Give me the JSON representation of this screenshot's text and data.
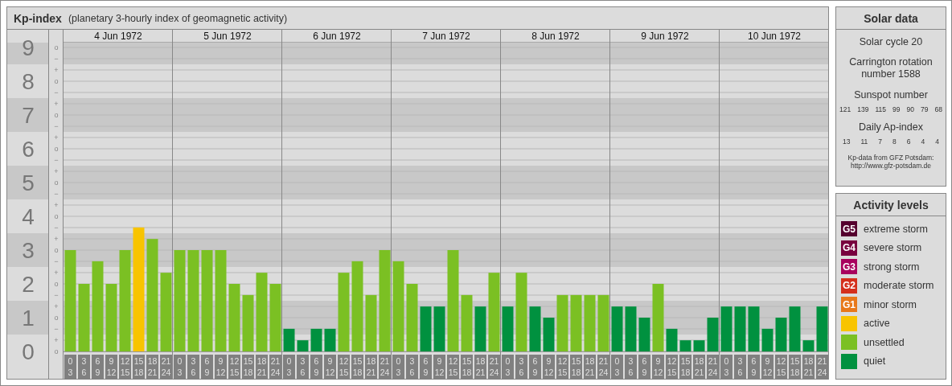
{
  "chart_panel": {
    "subtitle": "(planetary 3-hourly index of geomagnetic activity)",
    "chart_data": {
      "type": "bar",
      "title": "Kp-index",
      "grid": true,
      "ylim": [
        0,
        9
      ],
      "bands": [
        {
          "axis": "y",
          "from": 0.5,
          "to": 1.5
        },
        {
          "axis": "y",
          "from": 2.5,
          "to": 3.5
        },
        {
          "axis": "y",
          "from": 4.5,
          "to": 5.5
        },
        {
          "axis": "y",
          "from": 6.5,
          "to": 7.5
        },
        {
          "axis": "y",
          "from": 8.5,
          "to": 9.5
        }
      ],
      "yticks": [
        0,
        1,
        2,
        3,
        4,
        5,
        6,
        7,
        8,
        9
      ],
      "values": [
        3,
        2,
        2.67,
        2,
        3,
        3.67,
        3.33,
        2.33,
        3,
        3,
        3,
        3,
        2,
        1.67,
        2.33,
        2,
        0.67,
        0.33,
        0.67,
        0.67,
        2.33,
        2.67,
        1.67,
        3,
        2.67,
        2,
        1.33,
        1.33,
        3,
        1.67,
        1.33,
        2.33,
        1.33,
        2.33,
        1.33,
        1,
        1.67,
        1.67,
        1.67,
        1.67,
        1.33,
        1.33,
        1,
        2,
        0.67,
        0.33,
        0.33,
        1,
        1.33,
        1.33,
        1.33,
        0.67,
        1,
        1.33,
        0.33,
        1.33
      ]
    },
    "sublevel_labels": [
      "o",
      "−",
      "+",
      "o",
      "−",
      "+",
      "o",
      "−",
      "+",
      "o",
      "−",
      "+",
      "o",
      "−",
      "+",
      "o",
      "−",
      "+",
      "o",
      "−",
      "+",
      "o",
      "−",
      "+",
      "o",
      "−",
      "+",
      "o"
    ],
    "days": [
      {
        "label": "4 Jun 1972",
        "hours": [
          [
            "0",
            "3"
          ],
          [
            "3",
            "6"
          ],
          [
            "6",
            "9"
          ],
          [
            "9",
            "12"
          ],
          [
            "12",
            "15"
          ],
          [
            "15",
            "18"
          ],
          [
            "18",
            "21"
          ],
          [
            "21",
            "24"
          ]
        ]
      },
      {
        "label": "5 Jun 1972",
        "hours": [
          [
            "0",
            "3"
          ],
          [
            "3",
            "6"
          ],
          [
            "6",
            "9"
          ],
          [
            "9",
            "12"
          ],
          [
            "12",
            "15"
          ],
          [
            "15",
            "18"
          ],
          [
            "18",
            "21"
          ],
          [
            "21",
            "24"
          ]
        ]
      },
      {
        "label": "6 Jun 1972",
        "hours": [
          [
            "0",
            "3"
          ],
          [
            "3",
            "6"
          ],
          [
            "6",
            "9"
          ],
          [
            "9",
            "12"
          ],
          [
            "12",
            "15"
          ],
          [
            "15",
            "18"
          ],
          [
            "18",
            "21"
          ],
          [
            "21",
            "24"
          ]
        ]
      },
      {
        "label": "7 Jun 1972",
        "hours": [
          [
            "0",
            "3"
          ],
          [
            "3",
            "6"
          ],
          [
            "6",
            "9"
          ],
          [
            "9",
            "12"
          ],
          [
            "12",
            "15"
          ],
          [
            "15",
            "18"
          ],
          [
            "18",
            "21"
          ],
          [
            "21",
            "24"
          ]
        ]
      },
      {
        "label": "8 Jun 1972",
        "hours": [
          [
            "0",
            "3"
          ],
          [
            "3",
            "6"
          ],
          [
            "6",
            "9"
          ],
          [
            "9",
            "12"
          ],
          [
            "12",
            "15"
          ],
          [
            "15",
            "18"
          ],
          [
            "18",
            "21"
          ],
          [
            "21",
            "24"
          ]
        ]
      },
      {
        "label": "9 Jun 1972",
        "hours": [
          [
            "0",
            "3"
          ],
          [
            "3",
            "6"
          ],
          [
            "6",
            "9"
          ],
          [
            "9",
            "12"
          ],
          [
            "12",
            "15"
          ],
          [
            "15",
            "18"
          ],
          [
            "18",
            "21"
          ],
          [
            "21",
            "24"
          ]
        ]
      },
      {
        "label": "10 Jun 1972",
        "hours": [
          [
            "0",
            "3"
          ],
          [
            "3",
            "6"
          ],
          [
            "6",
            "9"
          ],
          [
            "9",
            "12"
          ],
          [
            "12",
            "15"
          ],
          [
            "15",
            "18"
          ],
          [
            "18",
            "21"
          ],
          [
            "21",
            "24"
          ]
        ]
      }
    ]
  },
  "solar_data": {
    "title": "Solar data",
    "solar_cycle": "Solar cycle 20",
    "carrington": "Carrington rotation number 1588",
    "sunspot_label": "Sunspot number",
    "sunspot_numbers": [
      "121",
      "139",
      "115",
      "99",
      "90",
      "79",
      "68"
    ],
    "ap_label": "Daily Ap-index",
    "ap_values": [
      "13",
      "11",
      "7",
      "8",
      "6",
      "4",
      "4"
    ],
    "source_note": "Kp-data from GFZ Potsdam:",
    "source_url": "http://www.gfz-potsdam.de"
  },
  "activity_levels": {
    "title": "Activity levels",
    "items": [
      {
        "badge": "G5",
        "label": "extreme storm",
        "color": "#55002e"
      },
      {
        "badge": "G4",
        "label": "severe storm",
        "color": "#78003f"
      },
      {
        "badge": "G3",
        "label": "strong storm",
        "color": "#a8005e"
      },
      {
        "badge": "G2",
        "label": "moderate storm",
        "color": "#d42f1c"
      },
      {
        "badge": "G1",
        "label": "minor storm",
        "color": "#e8781a"
      },
      {
        "label": "active",
        "color": "#f8c400"
      },
      {
        "label": "unsettled",
        "color": "#7bc023"
      },
      {
        "label": "quiet",
        "color": "#00913f"
      }
    ]
  }
}
